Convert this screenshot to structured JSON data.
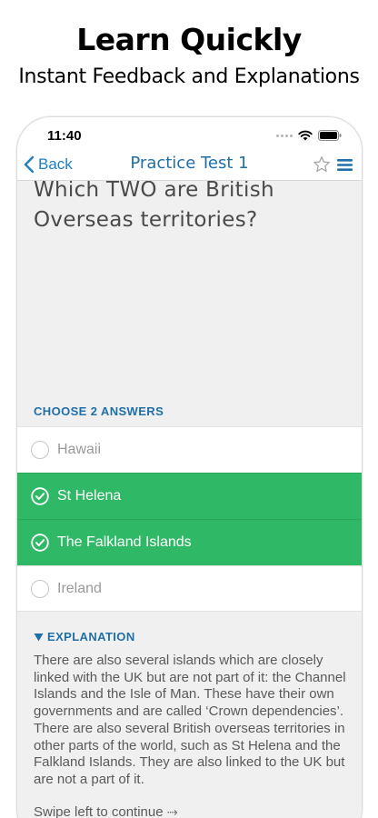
{
  "promo": {
    "title": "Learn Quickly",
    "subtitle": "Instant Feedback and Explanations"
  },
  "status_bar": {
    "time": "11:40"
  },
  "nav": {
    "back_label": "Back",
    "title": "Practice Test 1"
  },
  "question": {
    "text": "Which TWO are British Overseas territories?"
  },
  "answers_header": "CHOOSE 2 ANSWERS",
  "answers": [
    {
      "label": "Hawaii",
      "selected": false
    },
    {
      "label": "St Helena",
      "selected": true
    },
    {
      "label": "The Falkland Islands",
      "selected": true
    },
    {
      "label": "Ireland",
      "selected": false
    }
  ],
  "explanation": {
    "header": "EXPLANATION",
    "body": "There are also several islands which are closely linked with the UK but are not part of it: the Channel Islands and the Isle of Man. These have their own governments and are called ‘Crown dependencies’. There are also several British overseas territories in other parts of the world, such as St Helena and the Falkland Islands. They are also linked to the UK but are not a part of it.",
    "swipe_hint": "Swipe left to continue ⤑"
  },
  "colors": {
    "accent": "#1f6fa9",
    "link": "#1f7fc3",
    "correct": "#2fb866"
  },
  "icons": [
    "chevron-left-icon",
    "star-icon",
    "menu-icon",
    "wifi-icon",
    "battery-icon",
    "signal-dots-icon",
    "check-circle-icon",
    "radio-empty-icon",
    "triangle-down-icon"
  ]
}
